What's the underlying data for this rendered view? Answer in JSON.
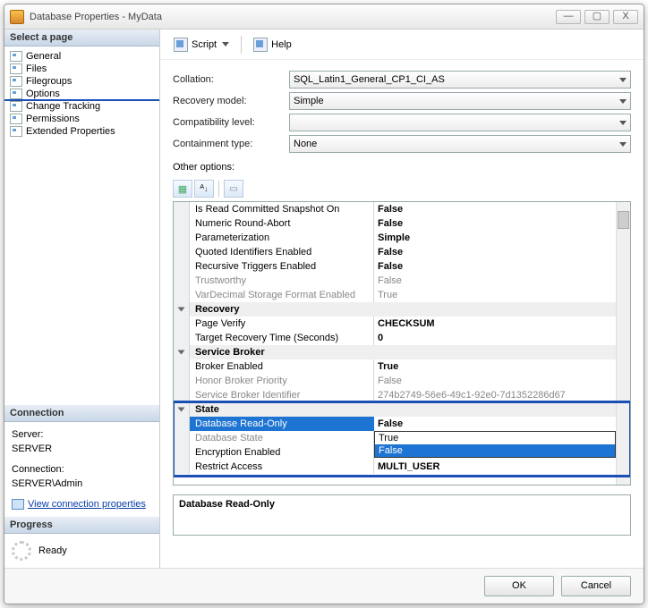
{
  "window": {
    "title": "Database Properties - MyData"
  },
  "winbuttons": {
    "min": "—",
    "max": "▢",
    "close": "X"
  },
  "toolbar": {
    "script": "Script",
    "help": "Help"
  },
  "left": {
    "select_page": "Select a page",
    "pages": [
      "General",
      "Files",
      "Filegroups",
      "Options",
      "Change Tracking",
      "Permissions",
      "Extended Properties"
    ],
    "connection_head": "Connection",
    "server_label": "Server:",
    "server_value": "SERVER",
    "connection_label": "Connection:",
    "connection_value": "SERVER\\Admin",
    "view_conn": "View connection properties",
    "progress_head": "Progress",
    "progress_value": "Ready"
  },
  "form": {
    "collation_label": "Collation:",
    "collation_value": "SQL_Latin1_General_CP1_CI_AS",
    "recovery_label": "Recovery model:",
    "recovery_value": "Simple",
    "compat_label": "Compatibility level:",
    "compat_value": "",
    "contain_label": "Containment type:",
    "contain_value": "None",
    "other_label": "Other options:"
  },
  "grid": {
    "rows": [
      {
        "type": "prop",
        "label": "Is Read Committed Snapshot On",
        "value": "False",
        "bold": true
      },
      {
        "type": "prop",
        "label": "Numeric Round-Abort",
        "value": "False",
        "bold": true
      },
      {
        "type": "prop",
        "label": "Parameterization",
        "value": "Simple",
        "bold": true
      },
      {
        "type": "prop",
        "label": "Quoted Identifiers Enabled",
        "value": "False",
        "bold": true
      },
      {
        "type": "prop",
        "label": "Recursive Triggers Enabled",
        "value": "False",
        "bold": true
      },
      {
        "type": "prop",
        "label": "Trustworthy",
        "value": "False",
        "disabled": true
      },
      {
        "type": "prop",
        "label": "VarDecimal Storage Format Enabled",
        "value": "True",
        "disabled": true
      },
      {
        "type": "cat",
        "label": "Recovery"
      },
      {
        "type": "prop",
        "label": "Page Verify",
        "value": "CHECKSUM",
        "bold": true
      },
      {
        "type": "prop",
        "label": "Target Recovery Time (Seconds)",
        "value": "0",
        "bold": true
      },
      {
        "type": "cat",
        "label": "Service Broker"
      },
      {
        "type": "prop",
        "label": "Broker Enabled",
        "value": "True",
        "bold": true
      },
      {
        "type": "prop",
        "label": "Honor Broker Priority",
        "value": "False",
        "disabled": true
      },
      {
        "type": "prop",
        "label": "Service Broker Identifier",
        "value": "274b2749-56e6-49c1-92e0-7d1352286d67",
        "disabled": true
      },
      {
        "type": "cat",
        "label": "State"
      },
      {
        "type": "prop",
        "label": "Database Read-Only",
        "value": "False",
        "bold": true,
        "selected": true
      },
      {
        "type": "prop",
        "label": "Database State",
        "value": "True",
        "disabled": true
      },
      {
        "type": "prop",
        "label": "Encryption Enabled",
        "value": "False",
        "bold": true
      },
      {
        "type": "prop",
        "label": "Restrict Access",
        "value": "MULTI_USER",
        "bold": true
      }
    ],
    "dropdown": {
      "options": [
        "True",
        "False"
      ],
      "selected": "False"
    }
  },
  "help": {
    "title": "Database Read-Only"
  },
  "buttons": {
    "ok": "OK",
    "cancel": "Cancel"
  }
}
